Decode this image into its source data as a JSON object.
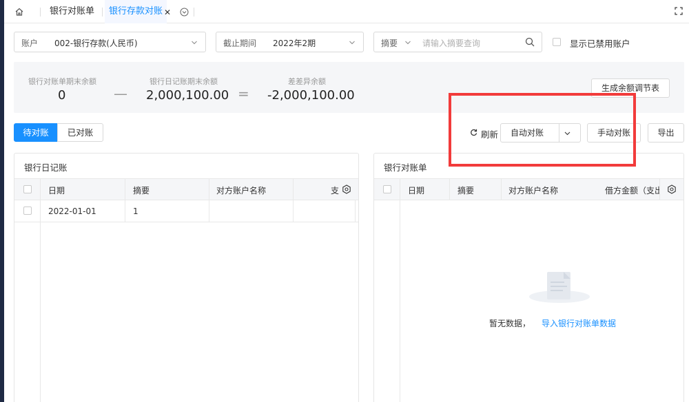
{
  "tabs": {
    "items": [
      {
        "label": "银行对账单"
      },
      {
        "label": "银行存款对账"
      }
    ]
  },
  "filters": {
    "account": {
      "label": "账户",
      "value": "002-银行存款(人民币)"
    },
    "period": {
      "label": "截止期间",
      "value": "2022年2期"
    },
    "summary": {
      "label": "摘要",
      "placeholder": "请输入摘要查询"
    },
    "show_disabled_label": "显示已禁用账户"
  },
  "summary": {
    "statement_caption": "银行对账单期末余额",
    "statement_value": "0",
    "operator_minus": "—",
    "journal_caption": "银行日记账期末余额",
    "journal_value": "2,000,100.00",
    "operator_equals": "=",
    "diff_caption": "差差异余额",
    "diff_value": "-2,000,100.00",
    "generate_button": "生成余额调节表"
  },
  "toolbar": {
    "pending_tab": "待对账",
    "done_tab": "已对账",
    "refresh": "刷新",
    "auto_reconcile": "自动对账",
    "manual_reconcile": "手动对账",
    "export": "导出"
  },
  "left_panel": {
    "title": "银行日记账",
    "columns": [
      "日期",
      "摘要",
      "对方账户名称",
      "支"
    ],
    "rows": [
      {
        "date": "2022-01-01",
        "summary": "1",
        "counterparty": ""
      }
    ]
  },
  "right_panel": {
    "title": "银行对账单",
    "columns": [
      "日期",
      "摘要",
      "对方账户名称",
      "借方金额（支出"
    ],
    "empty_text": "暂无数据，",
    "empty_link": "导入银行对账单数据"
  },
  "colors": {
    "accent": "#1890ff",
    "highlight": "#f23b3b"
  }
}
